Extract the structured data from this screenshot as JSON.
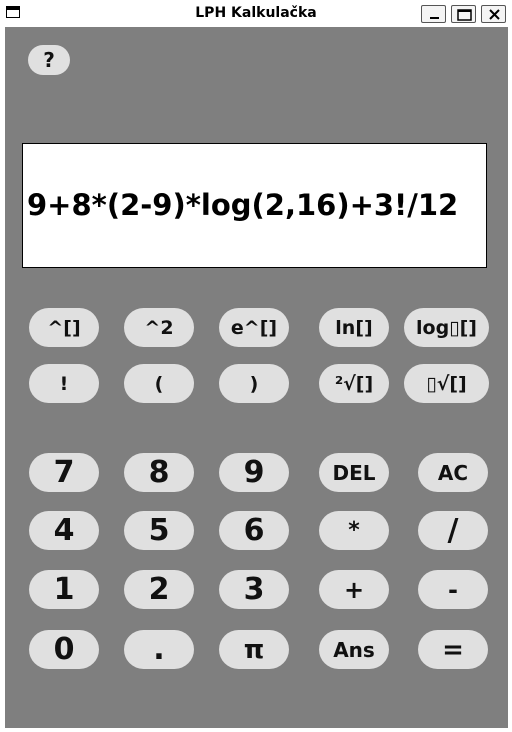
{
  "window": {
    "title": "LPH Kalkulačka"
  },
  "help_label": "?",
  "display": {
    "expression": "9+8*(2-9)*log(2,16)+3!/12"
  },
  "function_rows": [
    [
      "^[]",
      "^2",
      "e^[]",
      "ln[]",
      "log▯[]"
    ],
    [
      "!",
      "(",
      ")",
      "²√[]",
      "▯√[]"
    ]
  ],
  "keypad_rows": [
    [
      "7",
      "8",
      "9",
      "DEL",
      "AC"
    ],
    [
      "4",
      "5",
      "6",
      "*",
      "/"
    ],
    [
      "1",
      "2",
      "3",
      "+",
      "-"
    ],
    [
      "0",
      ".",
      "π",
      "Ans",
      "="
    ]
  ],
  "colors": {
    "background": "#7f7f7f",
    "button": "#e0e0e0",
    "display": "#ffffff"
  }
}
